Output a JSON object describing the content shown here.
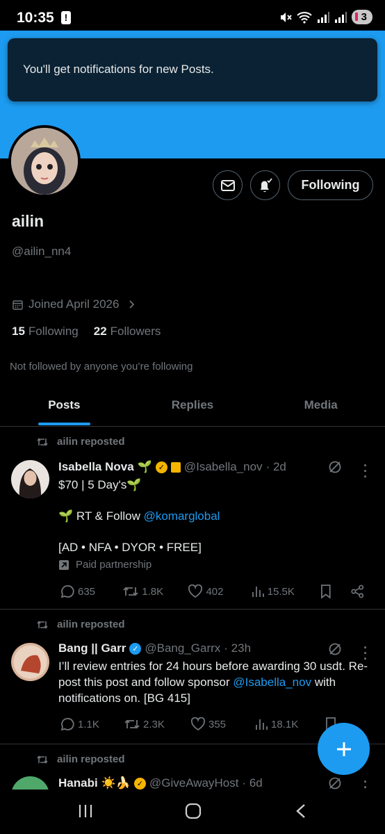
{
  "status_bar": {
    "time": "10:35",
    "notif_count": "3"
  },
  "toast": {
    "text": "You'll get notifications for new Posts."
  },
  "profile": {
    "name": "ailin",
    "handle": "@ailin_nn4",
    "joined": "Joined April 2026",
    "following_count": "15",
    "following_label": "Following",
    "followers_count": "22",
    "followers_label": "Followers",
    "not_followed": "Not followed by anyone you’re following",
    "following_button": "Following"
  },
  "tabs": [
    {
      "label": "Posts",
      "active": true
    },
    {
      "label": "Replies",
      "active": false
    },
    {
      "label": "Media",
      "active": false
    }
  ],
  "posts": [
    {
      "repost_label": "ailin reposted",
      "name": "Isabella Nova",
      "emoji": "🌱",
      "handle": "@Isabella_nov",
      "time": "· 2d",
      "line1": "$70 | 5 Day's",
      "line1_emoji": "🌱",
      "line2_emoji": "🌱",
      "line2_text": " RT & Follow ",
      "line2_link": "@komarglobal",
      "line3": "[AD • NFA • DYOR • FREE]",
      "paid": "Paid partnership",
      "replies": "635",
      "reposts": "1.8K",
      "likes": "402",
      "views": "15.5K"
    },
    {
      "repost_label": "ailin reposted",
      "name": "Bang || Garr",
      "handle": "@Bang_Garrx",
      "time": "· 23h",
      "text_a": "I’ll review entries for 24 hours before awarding 30 usdt. Re-post this post and follow sponsor ",
      "text_link": "@Isabella_nov",
      "text_b": " with notifications on. [BG 415]",
      "replies": "1.1K",
      "reposts": "2.3K",
      "likes": "355",
      "views": "18.1K"
    },
    {
      "repost_label": "ailin reposted",
      "name": "Hanabi",
      "emoji": "☀️🍌",
      "handle": "@GiveAwayHost",
      "time": "· 6d"
    }
  ],
  "colors": {
    "accent": "#1d9bf0",
    "muted": "#71767b",
    "divider": "#2f3336",
    "gold": "#f4b400"
  }
}
